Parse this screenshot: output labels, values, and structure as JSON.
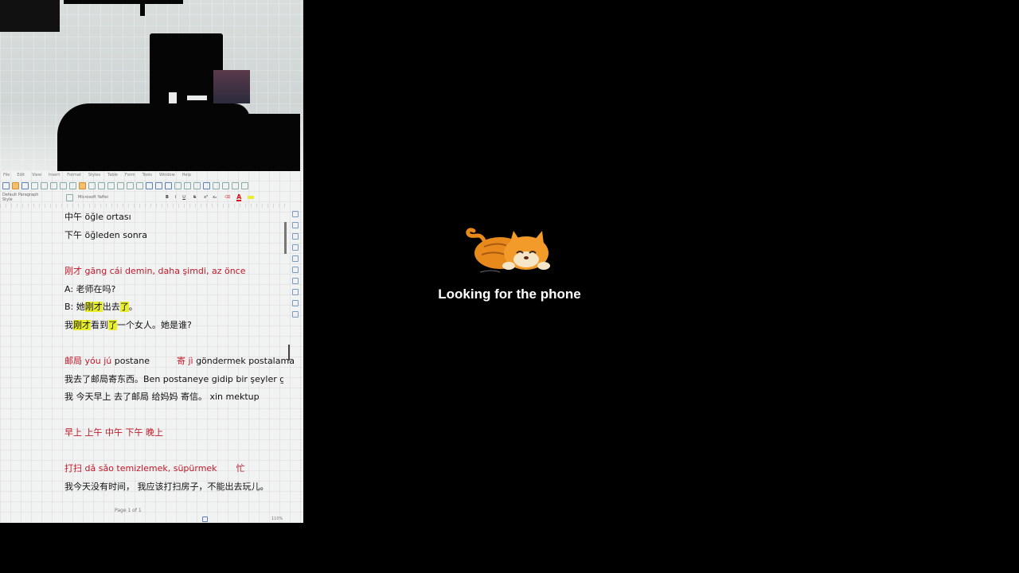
{
  "document": {
    "menu": [
      "File",
      "Edit",
      "View",
      "Insert",
      "Format",
      "Styles",
      "Table",
      "Form",
      "Tools",
      "Window",
      "Help"
    ],
    "paragraph_style": "Default Paragraph Style",
    "font_name": "Microsoft YaHei",
    "lines": [
      {
        "text": "中午  öğle ortası",
        "color": "black"
      },
      {
        "text": "下午  öğleden sonra",
        "color": "black"
      },
      {
        "text": "刚才  gāng cái demin, daha şimdi, az önce",
        "color": "red"
      },
      {
        "text": "A: 老师在吗?",
        "color": "black"
      },
      {
        "text": "我 今天早上  去了邮局   给妈妈   寄信。    xin mektup",
        "color": "black"
      },
      {
        "text": "早上    上午    中午    下午    晚上",
        "color": "red"
      },
      {
        "text": "我今天没有时间，  我应该打扫房子，不能出去玩儿。",
        "color": "black"
      }
    ],
    "line_b": {
      "p1": "B: 她",
      "p2": "刚才",
      "p3": "出去",
      "p4": "了",
      "p5": "。"
    },
    "line_c": {
      "p1": "我",
      "p2": "刚才",
      "p3": "看到",
      "p4": "了",
      "p5": "一个女人。她是谁?"
    },
    "line_post": {
      "r1": "邮局   yóu jú",
      "b1": " postane",
      "r2": "寄  jì",
      "b2": " göndermek postalama"
    },
    "line_post2": "我去了邮局寄东西。Ben postaneye gidip bir şeyler gönc",
    "line_clean": {
      "r1": "打扫   dǎ sǎo temizlemek, süpürmek",
      "r2": "忙"
    },
    "page_label": "Page 1 of 1",
    "zoom": "110%"
  },
  "overlay": {
    "status_text": "Looking for the phone",
    "icon": "sleeping-cat-icon",
    "accent": "#e8891c"
  }
}
